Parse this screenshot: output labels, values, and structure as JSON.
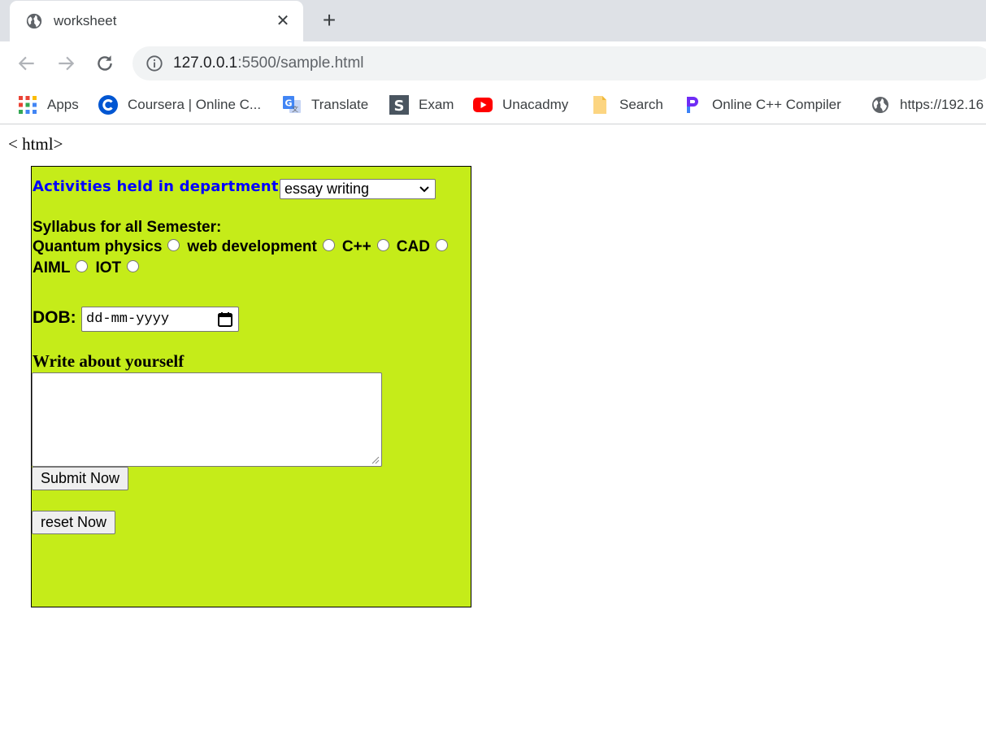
{
  "browser": {
    "tab": {
      "title": "worksheet",
      "icon": "globe-icon"
    },
    "toolbar": {
      "url_host": "127.0.0.1",
      "url_rest": ":5500/sample.html"
    },
    "bookmarks": [
      {
        "label": "Apps",
        "icon": "apps-grid-icon"
      },
      {
        "label": "Coursera | Online C...",
        "icon": "coursera-icon"
      },
      {
        "label": "Translate",
        "icon": "translate-icon"
      },
      {
        "label": "Exam",
        "icon": "exam-icon"
      },
      {
        "label": "Unacadmy",
        "icon": "youtube-icon"
      },
      {
        "label": "Search",
        "icon": "folder-icon"
      },
      {
        "label": "Online C++ Compiler",
        "icon": "programiz-icon"
      },
      {
        "label": "https://192.16",
        "icon": "globe-icon"
      }
    ]
  },
  "page": {
    "heading": "< html>",
    "form": {
      "background": "#c5ec19",
      "activities_label": "Activities held in department:",
      "activities_selected": "essay writing",
      "syllabus_title": "Syllabus for all Semester:",
      "syllabus_options_row1": [
        "Quantum physics",
        "web development",
        "C++",
        "CAD"
      ],
      "syllabus_options_row2": [
        "AIML",
        "IOT"
      ],
      "dob_label": "DOB:",
      "dob_placeholder": "dd-mm-yyyy",
      "about_label": "Write about yourself",
      "about_value": "",
      "submit_label": "Submit Now",
      "reset_label": "reset Now"
    }
  }
}
